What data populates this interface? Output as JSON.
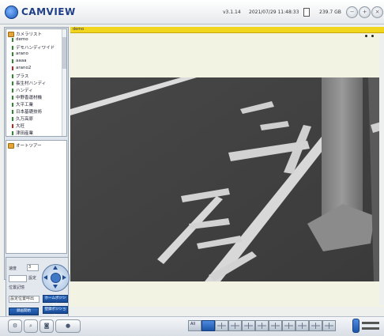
{
  "app": {
    "name": "CAMVIEW",
    "version": "v3.1.14",
    "datetime": "2021/07/29 11:48:33",
    "storage": "239.7 GB"
  },
  "camera_list": {
    "root_label": "カメラリスト",
    "items": [
      {
        "label": "demo",
        "status_color": "#2a8a2a"
      },
      {
        "label": "デモハンディワイド",
        "status_color": "#2a8a2a"
      },
      {
        "label": "arano",
        "status_color": "#2a8a2a"
      },
      {
        "label": "aaaa",
        "status_color": "#2a8a2a"
      },
      {
        "label": "arano2",
        "status_color": "#c02020"
      },
      {
        "label": "プラス",
        "status_color": "#2a8a2a"
      },
      {
        "label": "長生村ハンディ",
        "status_color": "#2a8a2a"
      },
      {
        "label": "ハンディ",
        "status_color": "#2a8a2a"
      },
      {
        "label": "中野香運材機",
        "status_color": "#2a8a2a"
      },
      {
        "label": "大平工業",
        "status_color": "#2a8a2a"
      },
      {
        "label": "日本基礎技術",
        "status_color": "#2a8a2a"
      },
      {
        "label": "久万高原",
        "status_color": "#2a8a2a"
      },
      {
        "label": "大旺",
        "status_color": "#c02020"
      },
      {
        "label": "津田産業",
        "status_color": "#2a8a2a"
      }
    ]
  },
  "auto_tour": {
    "label": "オートツアー"
  },
  "ptz": {
    "speed_label": "速度",
    "speed_value": "3",
    "preset_label": "設定",
    "position_label": "位置記憶",
    "recall_label": "設定位置呼出",
    "btn_home": "ホームポジション",
    "btn_preset": "登録ポジション",
    "btn_record": "録画開始"
  },
  "video": {
    "title": "demo"
  },
  "toolbar": {
    "icons": [
      "settings-icon",
      "search-icon",
      "camera-icon",
      "record-icon"
    ]
  },
  "colors": {
    "accent": "#f2d51d",
    "brand": "#1f3f8a",
    "active": "#1d56a8"
  }
}
